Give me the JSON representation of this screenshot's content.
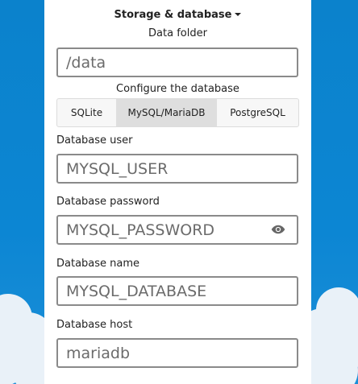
{
  "section": {
    "title": "Storage & database"
  },
  "data_folder": {
    "label": "Data folder",
    "value": "",
    "placeholder": "/data"
  },
  "database_config": {
    "label": "Configure the database",
    "tabs": [
      {
        "label": "SQLite",
        "active": false
      },
      {
        "label": "MySQL/MariaDB",
        "active": true
      },
      {
        "label": "PostgreSQL",
        "active": false
      }
    ]
  },
  "db_user": {
    "label": "Database user",
    "value": "",
    "placeholder": "MYSQL_USER"
  },
  "db_password": {
    "label": "Database password",
    "value": "",
    "placeholder": "MYSQL_PASSWORD",
    "toggle_icon": "eye-icon"
  },
  "db_name": {
    "label": "Database name",
    "value": "",
    "placeholder": "MYSQL_DATABASE"
  },
  "db_host": {
    "label": "Database host",
    "value": "",
    "placeholder": "mariadb"
  },
  "colors": {
    "background": "#0a84d0",
    "card": "#ffffff",
    "field_border": "#8a8a8a",
    "active_tab": "#dedede"
  }
}
